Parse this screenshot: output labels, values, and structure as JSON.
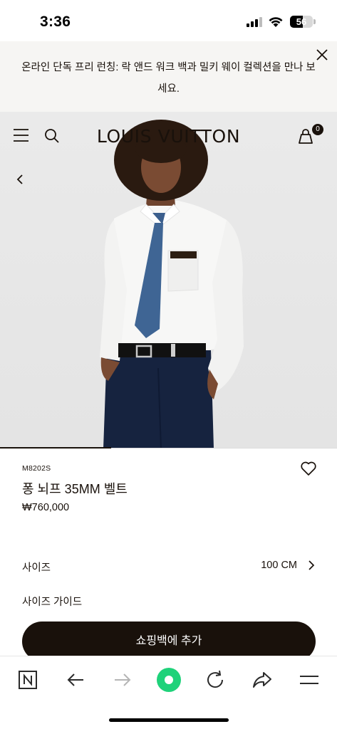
{
  "status_bar": {
    "time": "3:36",
    "battery_level": "56"
  },
  "promo": {
    "text": "온라인 단독 프리 런칭: 락 앤드 워크 백과 밀키 웨이 컬렉션을 만나 보세요."
  },
  "header": {
    "brand": "LOUIS VUITTON",
    "bag_count": "0"
  },
  "gallery": {
    "progress_fraction": 0.33
  },
  "product": {
    "sku": "M8202S",
    "name": "퐁 뇌프 35MM 벨트",
    "price": "₩760,000"
  },
  "size": {
    "label": "사이즈",
    "value": "100 CM",
    "guide_label": "사이즈 가이드"
  },
  "cta": {
    "add_to_bag": "쇼핑백에 추가"
  },
  "colors": {
    "brand_dark": "#19110b",
    "browser_accent": "#1fd27a"
  },
  "icons": {
    "menu": "menu-icon",
    "search": "search-icon",
    "bag": "shopping-bag-icon",
    "back": "chevron-left-icon",
    "wishlist": "heart-icon",
    "close": "close-icon"
  }
}
